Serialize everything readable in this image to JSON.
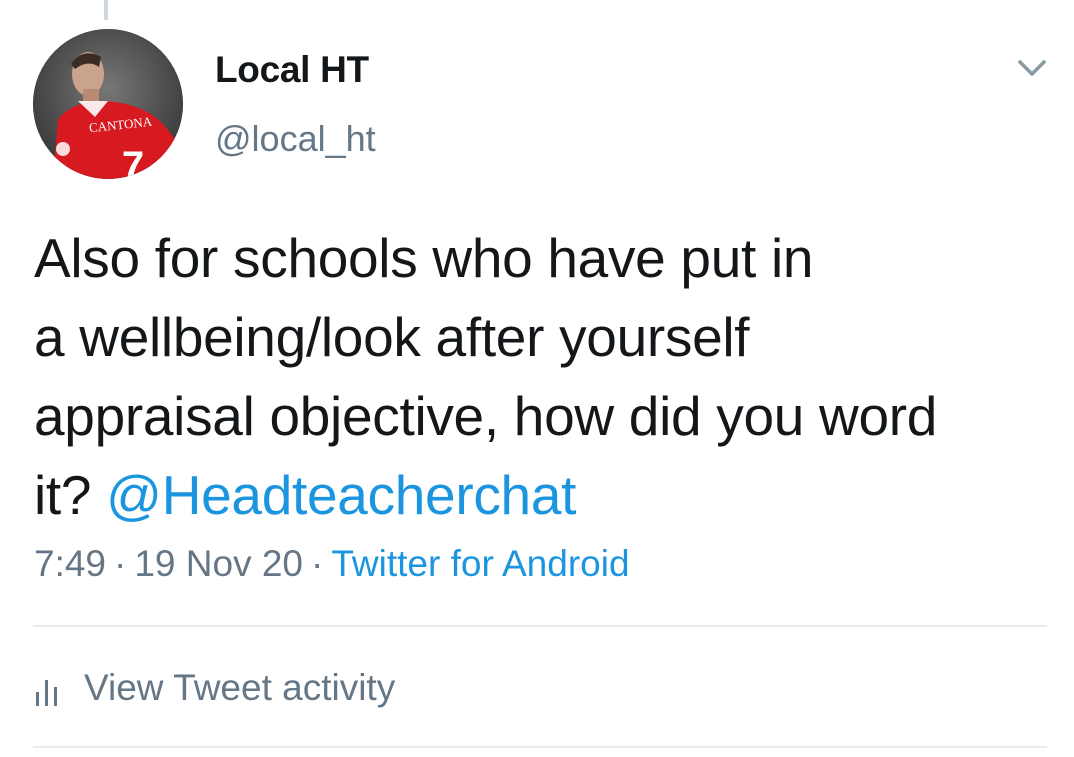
{
  "tweet": {
    "author": {
      "display_name": "Local HT",
      "handle": "@local_ht",
      "avatar_jersey_text": "CANTONA",
      "avatar_jersey_number": "7"
    },
    "text_lines": [
      "Also for schools who have put in",
      "a wellbeing/look after yourself",
      "appraisal objective, how did you word"
    ],
    "text_last_prefix": "it? ",
    "mention": "@Headteacherchat",
    "time": "7:49",
    "date": "19 Nov 20",
    "separator": "·",
    "source": "Twitter for Android",
    "activity_label": "View Tweet activity"
  },
  "icons": {
    "caret": "chevron-down-icon",
    "activity": "bar-chart-icon"
  },
  "colors": {
    "link": "#1b95e0",
    "secondary_text": "#657786",
    "primary_text": "#14171a",
    "divider": "#e6ecf0",
    "jersey_red": "#d71920"
  }
}
